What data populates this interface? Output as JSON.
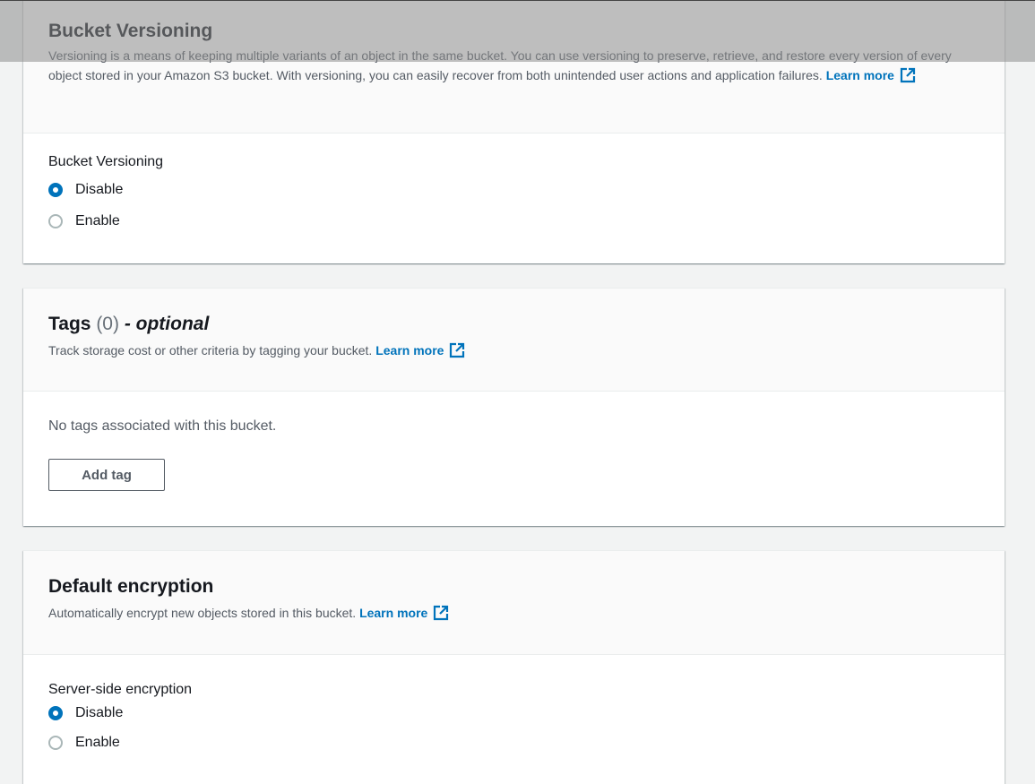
{
  "versioning": {
    "title": "Bucket Versioning",
    "description": "Versioning is a means of keeping multiple variants of an object in the same bucket. You can use versioning to preserve, retrieve, and restore every version of every object stored in your Amazon S3 bucket. With versioning, you can easily recover from both unintended user actions and application failures.",
    "learn_more": "Learn more",
    "field_label": "Bucket Versioning",
    "options": [
      "Disable",
      "Enable"
    ],
    "selected": "Disable"
  },
  "tags": {
    "title": "Tags",
    "count": "(0)",
    "optional": "- optional",
    "description": "Track storage cost or other criteria by tagging your bucket.",
    "learn_more": "Learn more",
    "empty_text": "No tags associated with this bucket.",
    "add_button": "Add tag"
  },
  "encryption": {
    "title": "Default encryption",
    "description": "Automatically encrypt new objects stored in this bucket.",
    "learn_more": "Learn more",
    "field_label": "Server-side encryption",
    "options": [
      "Disable",
      "Enable"
    ],
    "selected": "Disable"
  },
  "colors": {
    "accent": "#0073bb",
    "background": "#f2f3f3",
    "text": "#16191f"
  },
  "icons": {
    "external_link": "external-link-icon"
  }
}
